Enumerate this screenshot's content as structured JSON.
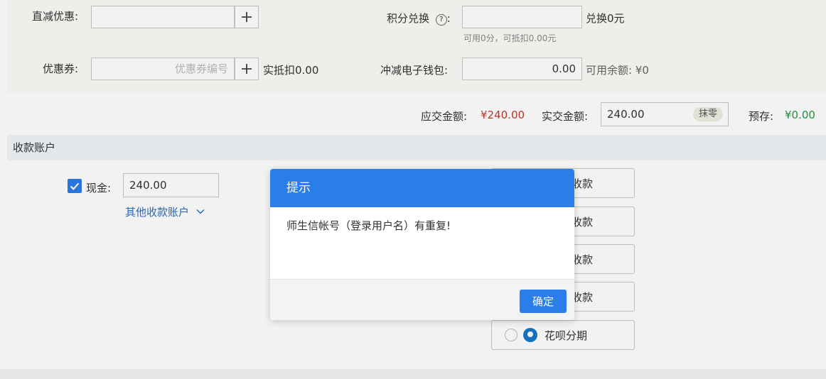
{
  "discount": {
    "direct_label": "直减优惠:",
    "direct_value": "",
    "coupon_label": "优惠券:",
    "coupon_placeholder": "优惠券编号",
    "coupon_deduct": "实抵扣0.00",
    "points_label": "积分兑换",
    "points_colon": ":",
    "points_value": "",
    "points_exchange": "兑换0元",
    "points_hint": "可用0分，可抵扣0.00元",
    "wallet_label": "冲减电子钱包:",
    "wallet_value": "0.00",
    "wallet_balance": "可用余额: ¥0"
  },
  "totals": {
    "due_label": "应交金额:",
    "due_value": "¥240.00",
    "paid_label": "实交金额:",
    "paid_value": "240.00",
    "round_label": "抹零",
    "prepaid_label": "预存:",
    "prepaid_value": "¥0.00"
  },
  "accounts": {
    "section_title": "收款账户",
    "cash_label": "现金:",
    "cash_value": "240.00",
    "other_accounts": "其他收款账户",
    "pay_options": [
      {
        "label": "收款"
      },
      {
        "label": "收款"
      },
      {
        "label": "收款"
      },
      {
        "label": "收款"
      },
      {
        "label": "花呗分期"
      }
    ]
  },
  "dialog": {
    "title": "提示",
    "message": "师生信帐号（登录用户名）有重复!",
    "ok_label": "确定"
  },
  "colors": {
    "accent": "#2b7de9",
    "due": "#c0392b",
    "prepaid": "#1e9e3e",
    "link": "#2b6cc4"
  }
}
